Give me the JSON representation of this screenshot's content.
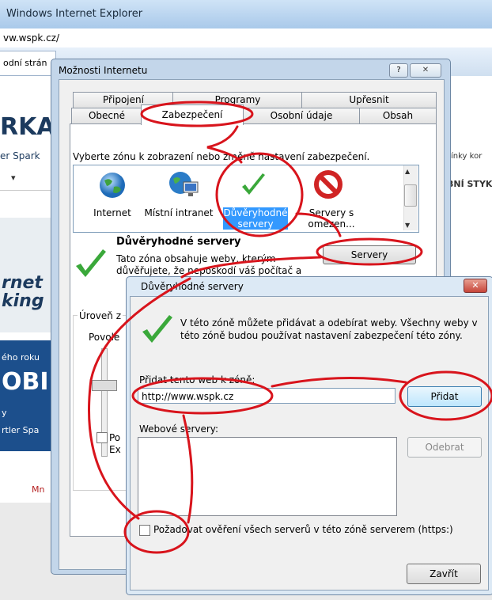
{
  "browser": {
    "title": "Windows Internet Explorer",
    "address": "vw.wspk.cz/",
    "tab_label": "odní strán"
  },
  "background_page": {
    "logo": "RKA",
    "logo_sub": "er Spark",
    "promo_line1": "rnet",
    "promo_line2": "king",
    "banner_line1": "ého roku",
    "banner_line2": "OBI",
    "banner_line3": "y",
    "banner_line4": "rtler Spa",
    "more_link": "Mn",
    "right_text1": "ínky  kor",
    "right_text2": "BNÍ STYK"
  },
  "internet_options": {
    "title": "Možnosti Internetu",
    "help_label": "?",
    "close_label": "✕",
    "tabs_row1": [
      "Připojení",
      "Programy",
      "Upřesnit"
    ],
    "tabs_row2": [
      "Obecné",
      "Zabezpečení",
      "Osobní údaje",
      "Obsah"
    ],
    "zone_caption": "Vyberte zónu k zobrazení nebo změně nastavení zabezpečení.",
    "zones": [
      {
        "label_line1": "Internet",
        "label_line2": "",
        "icon": "globe-icon"
      },
      {
        "label_line1": "Místní intranet",
        "label_line2": "",
        "icon": "intranet-icon"
      },
      {
        "label_line1": "Důvěryhodné",
        "label_line2": "servery",
        "icon": "checkmark-icon"
      },
      {
        "label_line1": "Servery s",
        "label_line2": "omezen...",
        "icon": "prohibited-icon"
      }
    ],
    "selected_zone_title": "Důvěryhodné servery",
    "selected_zone_desc": "Tato zóna obsahuje weby, kterým důvěřujete, že nepoškodí váš počítač a",
    "servers_button": "Servery",
    "level_label": "Úroveň z",
    "level_allowed": "Povole",
    "protected_mode_1": "Po",
    "protected_mode_2": "Ex"
  },
  "trusted_sites": {
    "title": "Důvěryhodné servery",
    "close_label": "✕",
    "info": "V této zóně můžete přidávat a odebírat weby. Všechny weby v této zóně budou používat nastavení zabezpečení této zóny.",
    "add_label": "Přidat tento web k zóně:",
    "add_value": "http://www.wspk.cz",
    "add_button": "Přidat",
    "list_label": "Webové servery:",
    "remove_button": "Odebrat",
    "https_label": "Požadovat ověření všech serverů v této zóně serverem (https:)",
    "close_button": "Zavřít"
  },
  "colors": {
    "annotation": "#d8141c",
    "selection": "#3399ff",
    "check_green": "#3aa83a"
  }
}
